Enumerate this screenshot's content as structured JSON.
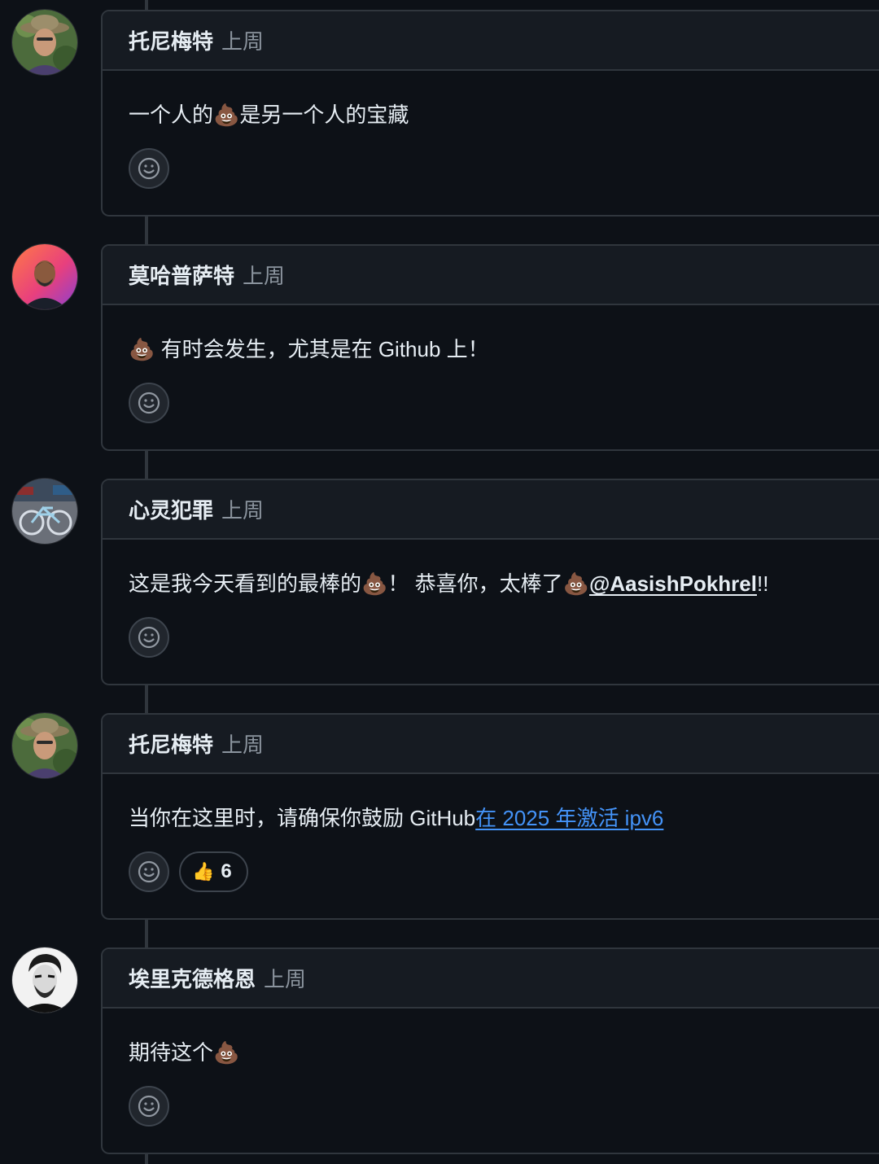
{
  "comments": [
    {
      "author": "托尼梅特",
      "time": "上周",
      "avatar": "person-hat-avatar",
      "body": [
        "一个人的",
        "💩",
        "是另一个人的宝藏"
      ]
    },
    {
      "author": "莫哈普萨特",
      "time": "上周",
      "avatar": "person-gradient-avatar",
      "body": [
        "💩",
        " 有时会发生，尤其是在 Github 上！"
      ]
    },
    {
      "author": "心灵犯罪",
      "time": "上周",
      "avatar": "bicycle-avatar",
      "body_pre": "这是我今天看到的最棒的",
      "body_mid": "！ 恭喜你，太棒了",
      "mention": "@AasishPokhrel",
      "body_post": "!!"
    },
    {
      "author": "托尼梅特",
      "time": "上周",
      "avatar": "person-hat-avatar",
      "body_pre": "当你在这里时，请确保你鼓励 GitHub",
      "link": "在 2025 年激活 ipv6",
      "reaction": {
        "icon": "thumbs-up-icon",
        "emoji": "👍",
        "count": "6"
      }
    },
    {
      "author": "埃里克德格恩",
      "time": "上周",
      "avatar": "sketch-portrait-avatar",
      "body": [
        "期待这个",
        "💩"
      ]
    }
  ],
  "colors": {
    "background": "#0d1117",
    "header": "#161b22",
    "border": "#30363d",
    "link": "#4493f8",
    "muted": "#8b949e"
  }
}
